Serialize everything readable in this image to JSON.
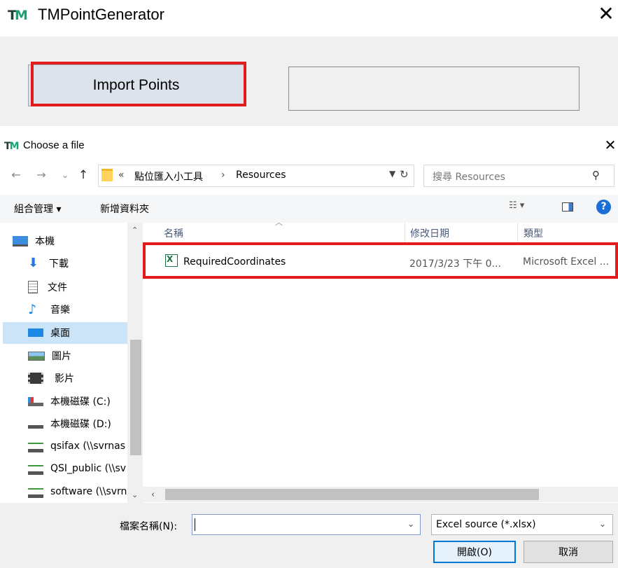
{
  "app": {
    "logo": {
      "t": "T",
      "m": "M"
    },
    "title": "TMPointGenerator",
    "close": "✕",
    "import_button": "Import Points",
    "path_display": ""
  },
  "dialog": {
    "title": "Choose a file",
    "close": "✕",
    "nav": {
      "back": "←",
      "forward": "→",
      "recent": "⌄",
      "up": "↑"
    },
    "breadcrumb": [
      "«",
      "點位匯入小工具",
      "›",
      "Resources"
    ],
    "search_placeholder": "搜尋 Resources",
    "toolbar": {
      "organize": "組合管理 ▾",
      "new_folder": "新增資料夾"
    },
    "nav_items": [
      {
        "label": "本機",
        "icon": "computer-icon"
      },
      {
        "label": "下載",
        "icon": "download-icon"
      },
      {
        "label": "文件",
        "icon": "document-icon"
      },
      {
        "label": "音樂",
        "icon": "music-icon"
      },
      {
        "label": "桌面",
        "icon": "desktop-icon",
        "selected": true
      },
      {
        "label": "圖片",
        "icon": "picture-icon"
      },
      {
        "label": "影片",
        "icon": "video-icon"
      },
      {
        "label": "本機磁碟 (C:)",
        "icon": "drive-icon"
      },
      {
        "label": "本機磁碟 (D:)",
        "icon": "drive-icon"
      },
      {
        "label": "qsifax (\\\\svrnas",
        "icon": "network-drive-icon"
      },
      {
        "label": "QSI_public (\\\\sv",
        "icon": "network-drive-icon"
      },
      {
        "label": "software (\\\\svrn",
        "icon": "network-drive-icon"
      }
    ],
    "columns": {
      "name": "名稱",
      "date": "修改日期",
      "type": "類型"
    },
    "files": [
      {
        "name": "RequiredCoordinates",
        "date": "2017/3/23 下午 0...",
        "type": "Microsoft Excel ..."
      }
    ],
    "filename_label": "檔案名稱(N):",
    "filename_value": "",
    "filter": "Excel source (*.xlsx)",
    "open_button": "開啟(O)",
    "cancel_button": "取消"
  },
  "colors": {
    "highlight": "#e21c1c",
    "selection": "#cce4f7",
    "accent": "#0078d7"
  }
}
